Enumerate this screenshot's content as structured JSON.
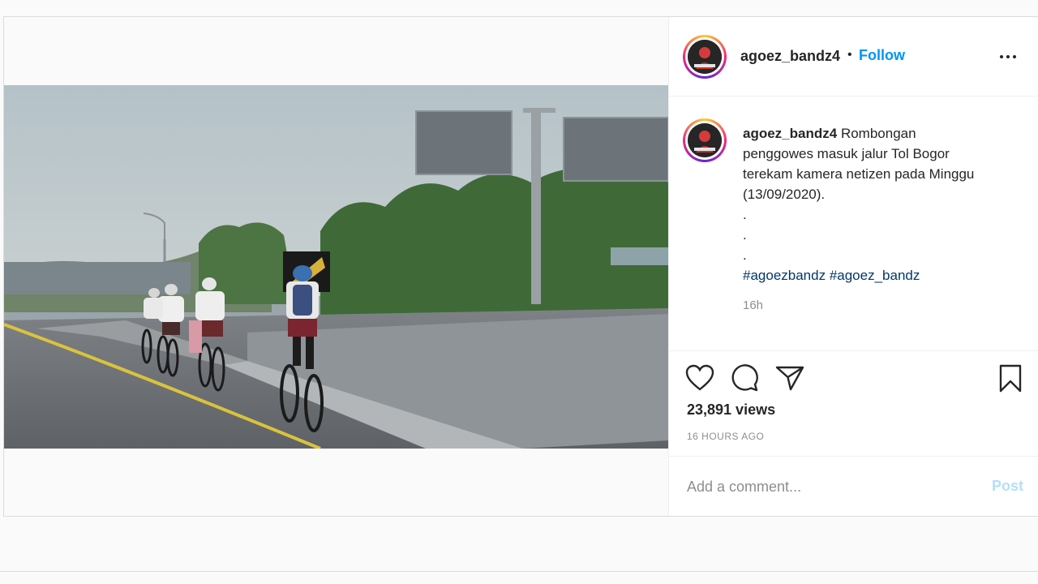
{
  "post": {
    "username": "agoez_bandz4",
    "follow_label": "Follow",
    "separator": "•",
    "caption": {
      "username": "agoez_bandz4",
      "lines": [
        "Rombongan",
        "penggowes masuk jalur Tol Bogor",
        "terekam kamera netizen pada Minggu",
        "(13/09/2020)."
      ],
      "dots": [
        ".",
        ".",
        "."
      ],
      "hashtags": "#agoezbandz #agoez_bandz",
      "time_ago": "16h"
    },
    "views": "23,891 views",
    "date": "16 HOURS AGO",
    "comment": {
      "placeholder": "Add a comment...",
      "value": "",
      "post_label": "Post"
    }
  },
  "icons": {
    "more": "more-horizontal-icon",
    "like": "heart-icon",
    "comment": "comment-bubble-icon",
    "share": "paper-plane-icon",
    "save": "bookmark-icon"
  },
  "colors": {
    "follow": "#0095f6",
    "hashtag": "#00376b",
    "muted": "#8e8e8e",
    "post_disabled": "#b2dffc"
  }
}
